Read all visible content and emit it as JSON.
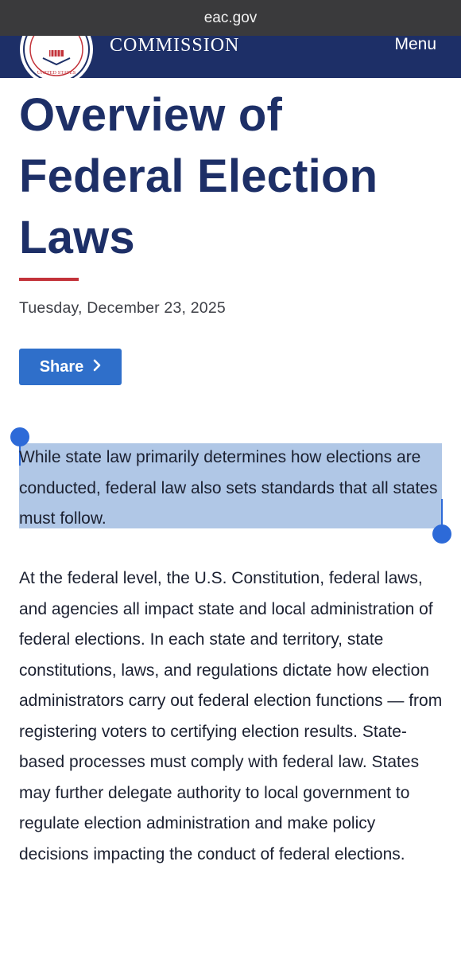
{
  "browser": {
    "url": "eac.gov"
  },
  "header": {
    "site_name": "COMMISSION",
    "menu_label": "Menu",
    "seal_text": "UNITED STATES"
  },
  "article": {
    "title": "Overview of Federal Election Laws",
    "date": "Tuesday, December 23, 2025",
    "share_label": "Share",
    "lead": "While state law primarily determines how elections are conducted, federal law also sets standards that all states must follow.",
    "body": "At the federal level, the U.S. Constitution, federal laws, and agencies all impact state and local administration of federal elections. In each state and territory, state constitutions, laws, and regulations dictate how election administrators carry out federal election functions — from registering voters to certifying election results. State-based processes must comply with federal law. States may further delegate authority to local government to regulate election administration and make policy decisions impacting the conduct of federal elections."
  },
  "colors": {
    "header_bg": "#1d2f67",
    "title": "#1d2f67",
    "accent_rule": "#c3333a",
    "share_bg": "#2f6fca",
    "selection": "#b0c7e6",
    "handle": "#2d6ad8"
  },
  "icons": {
    "share_chevron": "chevron-right-icon",
    "seal": "seal-icon"
  }
}
